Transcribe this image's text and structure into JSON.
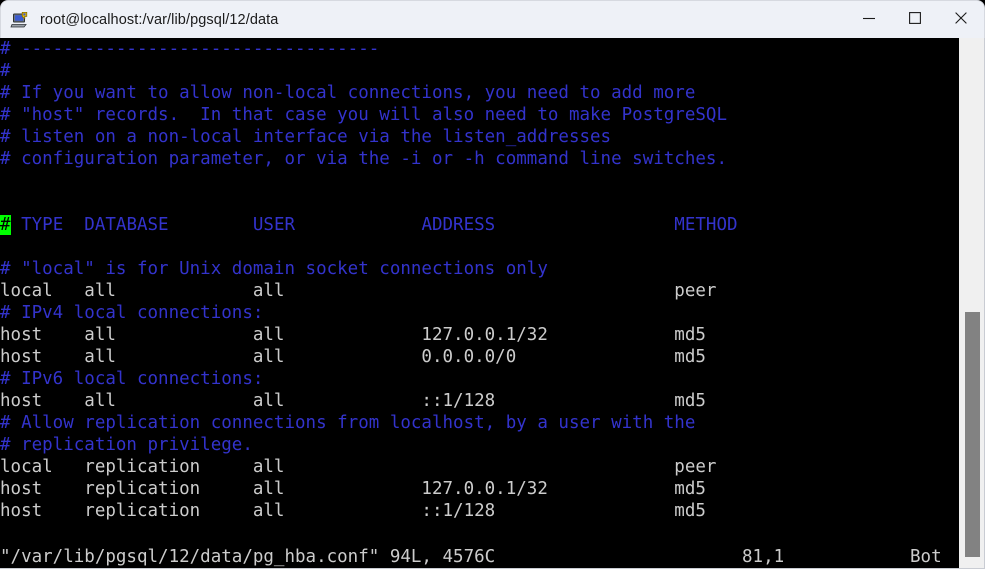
{
  "window": {
    "title": "root@localhost:/var/lib/pgsql/12/data",
    "icon": "putty-session-icon",
    "controls": {
      "minimize": "minimize-icon",
      "maximize": "maximize-icon",
      "close": "close-icon"
    },
    "titlebar_bg": "#eef1f7",
    "title_color": "#1b1b1b"
  },
  "terminal": {
    "bg": "#000000",
    "fg": "#cccccc",
    "comment_color": "#3333cc",
    "cursor_bg": "#00ff00",
    "cursor_fg": "#000000",
    "lines": [
      {
        "type": "comment",
        "text": "# ----------------------------------"
      },
      {
        "type": "comment",
        "text": "#"
      },
      {
        "type": "comment",
        "text": "# If you want to allow non-local connections, you need to add more"
      },
      {
        "type": "comment",
        "text": "# \"host\" records.  In that case you will also need to make PostgreSQL"
      },
      {
        "type": "comment",
        "text": "# listen on a non-local interface via the listen_addresses"
      },
      {
        "type": "comment",
        "text": "# configuration parameter, or via the -i or -h command line switches."
      },
      {
        "type": "blank",
        "text": ""
      },
      {
        "type": "blank",
        "text": ""
      },
      {
        "type": "comment",
        "text": "# TYPE  DATABASE        USER            ADDRESS                 METHOD",
        "cursor_col": 0
      },
      {
        "type": "blank",
        "text": ""
      },
      {
        "type": "comment",
        "text": "# \"local\" is for Unix domain socket connections only"
      },
      {
        "type": "conf",
        "text": "local   all             all                                     peer"
      },
      {
        "type": "comment",
        "text": "# IPv4 local connections:"
      },
      {
        "type": "conf",
        "text": "host    all             all             127.0.0.1/32            md5"
      },
      {
        "type": "conf",
        "text": "host    all             all             0.0.0.0/0               md5"
      },
      {
        "type": "comment",
        "text": "# IPv6 local connections:"
      },
      {
        "type": "conf",
        "text": "host    all             all             ::1/128                 md5"
      },
      {
        "type": "comment",
        "text": "# Allow replication connections from localhost, by a user with the"
      },
      {
        "type": "comment",
        "text": "# replication privilege."
      },
      {
        "type": "conf",
        "text": "local   replication     all                                     peer"
      },
      {
        "type": "conf",
        "text": "host    replication     all             127.0.0.1/32            md5"
      },
      {
        "type": "conf",
        "text": "host    replication     all             ::1/128                 md5"
      }
    ],
    "status": {
      "file": "\"/var/lib/pgsql/12/data/pg_hba.conf\" 94L, 4576C",
      "position": "81,1",
      "percent": "Bot"
    }
  },
  "scrollbar": {
    "name": "vertical-scrollbar",
    "track_color": "#f0f0f0",
    "thumb_color": "#828282"
  }
}
